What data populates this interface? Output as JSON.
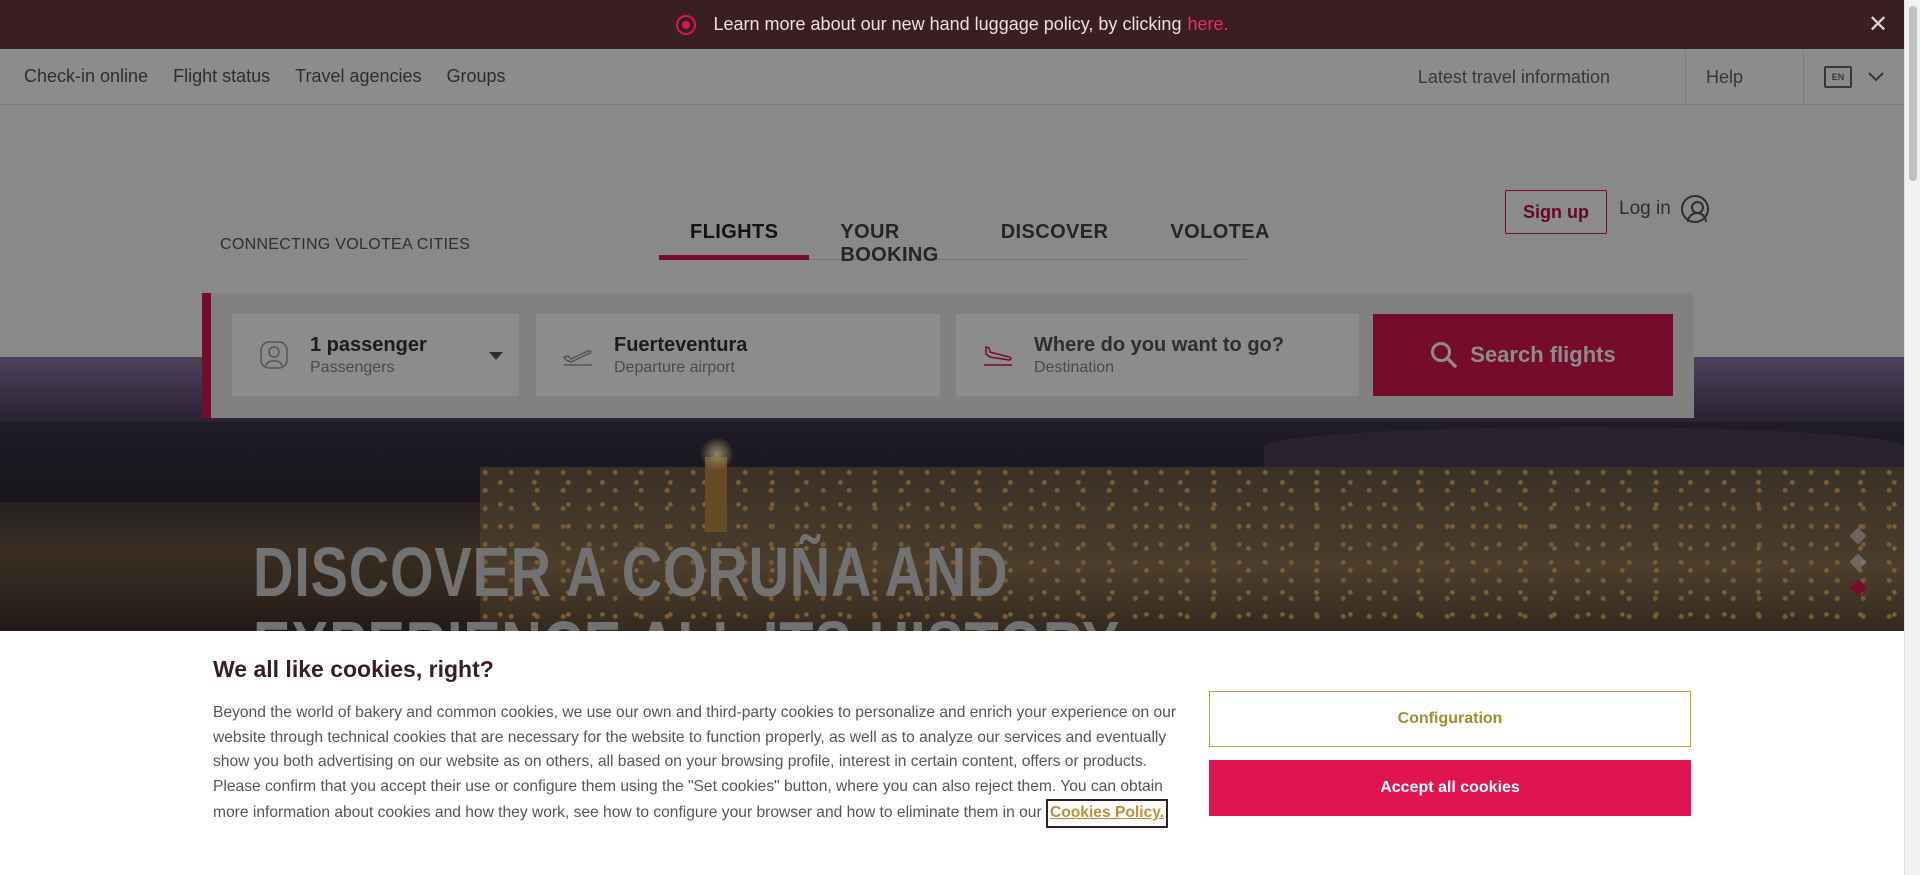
{
  "announcement": {
    "text": "Learn more about our new hand luggage policy, by clicking",
    "link": "here."
  },
  "topnav": {
    "left": [
      "Check-in online",
      "Flight status",
      "Travel agencies",
      "Groups"
    ],
    "latest": "Latest travel information",
    "help": "Help",
    "lang_code": "EN"
  },
  "header": {
    "tagline": "CONNECTING VOLOTEA CITIES",
    "tabs": [
      "FLIGHTS",
      "YOUR BOOKING",
      "DISCOVER",
      "VOLOTEA"
    ],
    "active_tab": "FLIGHTS",
    "signup": "Sign up",
    "login": "Log in"
  },
  "search": {
    "passengers_value": "1 passenger",
    "passengers_label": "Passengers",
    "departure_value": "Fuerteventura",
    "departure_label": "Departure airport",
    "destination_placeholder": "Where do you want to go?",
    "destination_label": "Destination",
    "button": "Search flights"
  },
  "hero": {
    "title_line1": "DISCOVER A CORUÑA AND",
    "title_line2": "EXPERIENCE ALL ITS HISTORY",
    "carousel_count": 3,
    "carousel_active": 3
  },
  "cookie": {
    "title": "We all like cookies, right?",
    "body": "Beyond the world of bakery and common cookies, we use our own and third-party cookies to personalize and enrich your experience on our website through technical cookies that are necessary for the website to function properly, as well as to analyze our services and eventually show you both advertising on our website as on others, all based on your browsing profile, interest in certain content, offers or products. Please confirm that you accept their use or configure them using the \"Set cookies\" button, where you can also reject them. You can obtain more information about cookies and how they work, see how to configure your browser and how to eliminate them in our",
    "policy_link": "Cookies Policy.",
    "config_button": "Configuration",
    "accept_button": "Accept all cookies"
  },
  "colors": {
    "brand": "#d8174f",
    "announce_bg": "#3a1e22",
    "config_border": "#b8a23a"
  },
  "icons": {
    "announce": "target-dot-icon",
    "close": "close-icon",
    "language": "speech-bubble-icon",
    "chevron": "chevron-down-icon",
    "user": "user-circle-icon",
    "passenger": "person-icon",
    "departure": "plane-takeoff-icon",
    "arrival": "plane-landing-icon",
    "search": "search-icon"
  }
}
